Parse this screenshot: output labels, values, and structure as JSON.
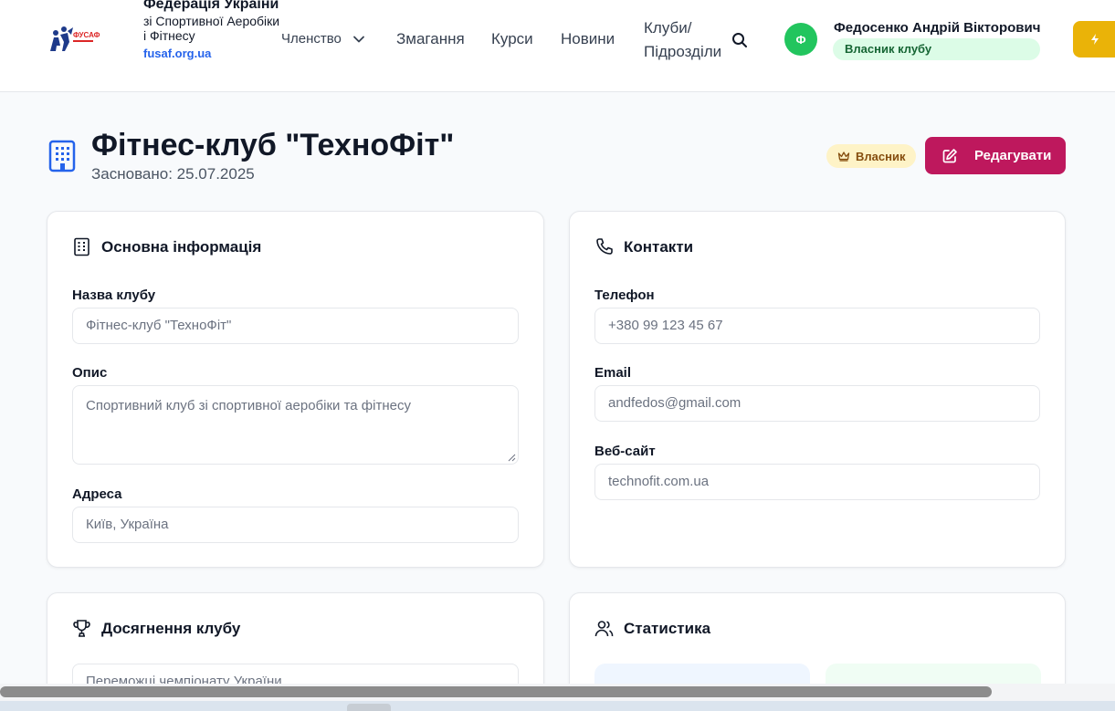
{
  "header": {
    "brand_title": "Федерація України",
    "brand_subtitle": "зі Спортивної Аеробіки і Фітнесу",
    "brand_url": "fusaf.org.ua",
    "logo_text": "ФУСАФ",
    "nav": {
      "membership": "Членство",
      "competitions": "Змагання",
      "courses": "Курси",
      "news": "Новини",
      "clubs_line1": "Клуби/",
      "clubs_line2": "Підрозділи"
    },
    "user": {
      "avatar_letter": "Ф",
      "name": "Федосенко Андрій Вікторович",
      "role": "Власник клубу"
    }
  },
  "club": {
    "title": "Фітнес-клуб \"ТехноФіт\"",
    "founded_label": "Засновано:",
    "founded_date": "25.07.2025",
    "owner_badge": "Власник",
    "edit_button": "Редагувати"
  },
  "basic_info": {
    "title": "Основна інформація",
    "name_label": "Назва клубу",
    "name_value": "Фітнес-клуб \"ТехноФіт\"",
    "description_label": "Опис",
    "description_value": "Спортивний клуб зі спортивної аеробіки та фітнесу",
    "address_label": "Адреса",
    "address_value": "Київ, Україна"
  },
  "contacts": {
    "title": "Контакти",
    "phone_label": "Телефон",
    "phone_value": "+380 99 123 45 67",
    "email_label": "Email",
    "email_value": "andfedos@gmail.com",
    "website_label": "Веб-сайт",
    "website_value": "technofit.com.ua"
  },
  "achievements": {
    "title": "Досягнення клубу",
    "first_value": "Переможці чемпіонату України"
  },
  "stats": {
    "title": "Статистика"
  },
  "colors": {
    "accent": "#be185d",
    "success": "#22c55e",
    "brand_link": "#2563eb",
    "owner_badge_bg": "#fef3c7"
  }
}
